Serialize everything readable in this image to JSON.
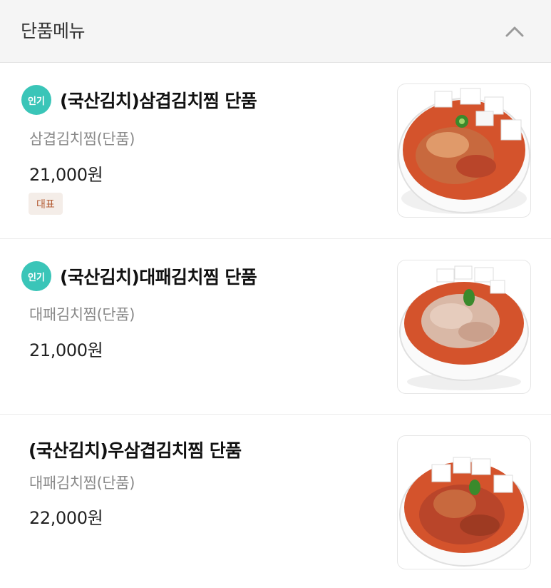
{
  "section": {
    "title": "단품메뉴",
    "collapse_icon": "chevron-up-icon"
  },
  "items": [
    {
      "name": "(국산김치)삼겹김치찜 단품",
      "description": "삼겹김치찜(단품)",
      "price": "21,000원",
      "badge": "인기",
      "tag": "대표"
    },
    {
      "name": "(국산김치)대패김치찜 단품",
      "description": "대패김치찜(단품)",
      "price": "21,000원",
      "badge": "인기"
    },
    {
      "name": "(국산김치)우삼겹김치찜 단품",
      "description": "대패김치찜(단품)",
      "price": "22,000원"
    }
  ],
  "colors": {
    "popular_badge": "#3ac5b8",
    "tag_bg": "#f4ede8",
    "tag_text": "#b35b33",
    "stew": "#d4532c"
  }
}
